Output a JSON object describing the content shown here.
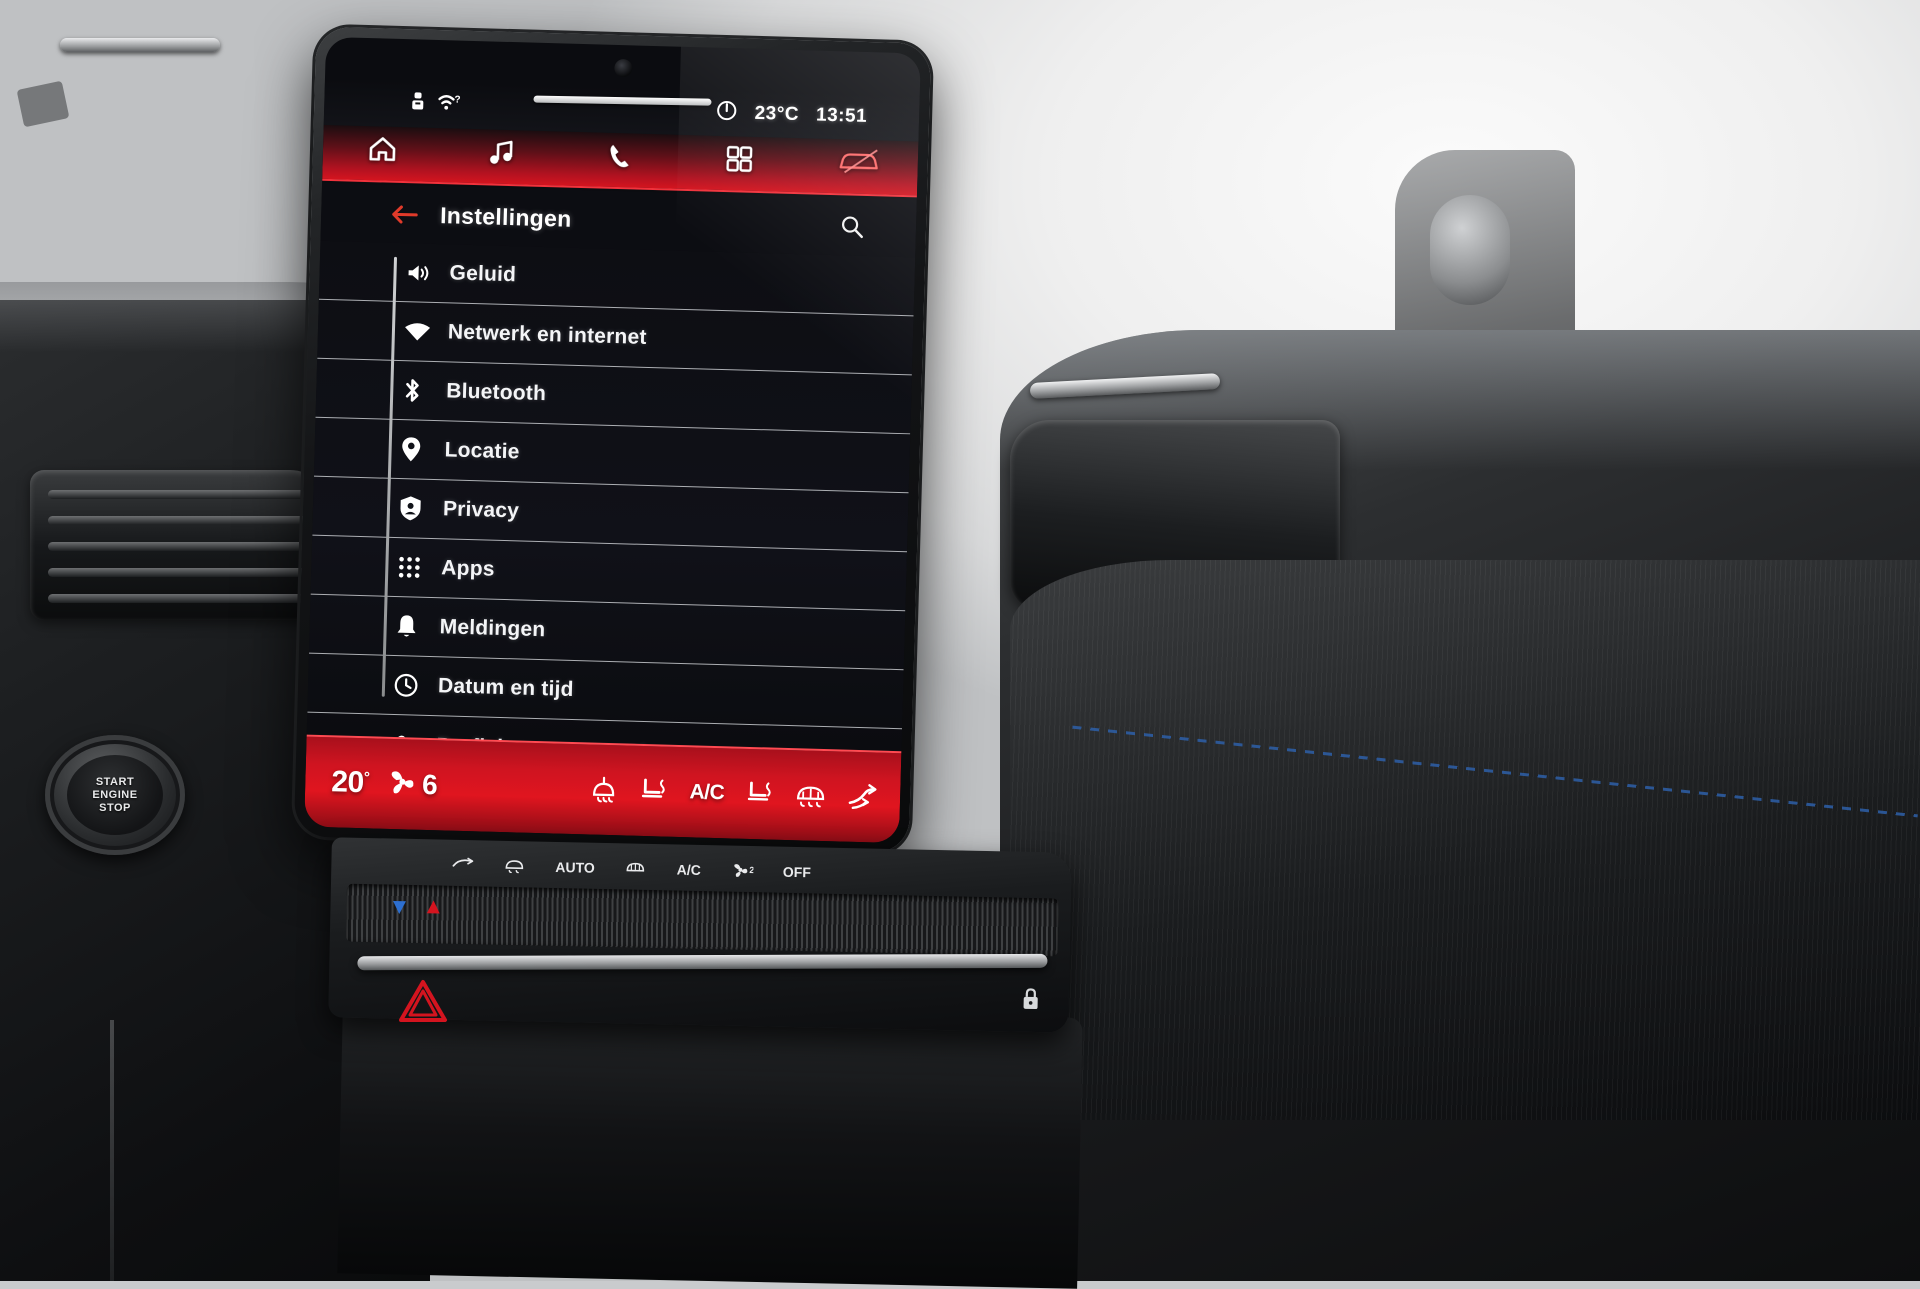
{
  "statusbar": {
    "seatbelt_icon": "seatbelt-icon",
    "wifi_icon": "wifi-question-icon",
    "power_icon": "power-icon",
    "temperature": "23°C",
    "clock": "13:51"
  },
  "navbar": {
    "items": [
      {
        "id": "home",
        "icon": "home-icon",
        "label": "Home"
      },
      {
        "id": "media",
        "icon": "music-note-icon",
        "label": "Media"
      },
      {
        "id": "phone",
        "icon": "phone-icon",
        "label": "Telefoon"
      },
      {
        "id": "apps",
        "icon": "apps-grid-icon",
        "label": "Apps"
      },
      {
        "id": "vehicle",
        "icon": "car-icon",
        "label": "Voertuig"
      }
    ],
    "active_item": "vehicle"
  },
  "header": {
    "back_icon": "back-arrow-icon",
    "title": "Instellingen",
    "search_icon": "search-icon"
  },
  "settings": {
    "items": [
      {
        "icon": "speaker-volume-icon",
        "label": "Geluid"
      },
      {
        "icon": "wifi-icon",
        "label": "Netwerk en internet"
      },
      {
        "icon": "bluetooth-icon",
        "label": "Bluetooth"
      },
      {
        "icon": "location-pin-icon",
        "label": "Locatie"
      },
      {
        "icon": "privacy-shield-icon",
        "label": "Privacy"
      },
      {
        "icon": "apps-dots-icon",
        "label": "Apps"
      },
      {
        "icon": "bell-icon",
        "label": "Meldingen"
      },
      {
        "icon": "clock-icon",
        "label": "Datum en tijd"
      },
      {
        "icon": "people-icon",
        "label": "Profielen en accounts"
      }
    ]
  },
  "climate": {
    "temperature": "20",
    "temperature_unit": "°",
    "fan_icon": "fan-icon",
    "fan_speed": "6",
    "controls": [
      {
        "icon": "windscreen-defrost-icon",
        "label": "Voorruitverwarming"
      },
      {
        "icon": "seat-heat-left-icon",
        "label": "Stoelverwarming links"
      },
      {
        "icon": "ac-icon",
        "label": "A/C"
      },
      {
        "icon": "seat-heat-right-icon",
        "label": "Stoelverwarming rechts"
      },
      {
        "icon": "rear-defrost-icon",
        "label": "Achterruitverwarming"
      },
      {
        "icon": "airflow-icon",
        "label": "Luchtstroom"
      }
    ],
    "accent_color": "#d4141f"
  },
  "physical_console": {
    "labels": [
      "AUTO",
      "A/C",
      "OFF"
    ],
    "recirc_icon": "recirculation-icon",
    "defrost_icon": "defrost-icon",
    "rear_defrost_icon": "rear-defrost-icon",
    "fan_icon": "fan-icon",
    "lock_icon": "lock-icon",
    "hazard_icon": "hazard-triangle-icon",
    "up_chevron": "▲",
    "down_chevron": "▼"
  },
  "start_button": {
    "line1": "START",
    "line2": "ENGINE",
    "line3": "STOP"
  },
  "colors": {
    "brand_red": "#d4141f",
    "screen_bg": "#0d0e13",
    "text": "#f4f5f7"
  }
}
